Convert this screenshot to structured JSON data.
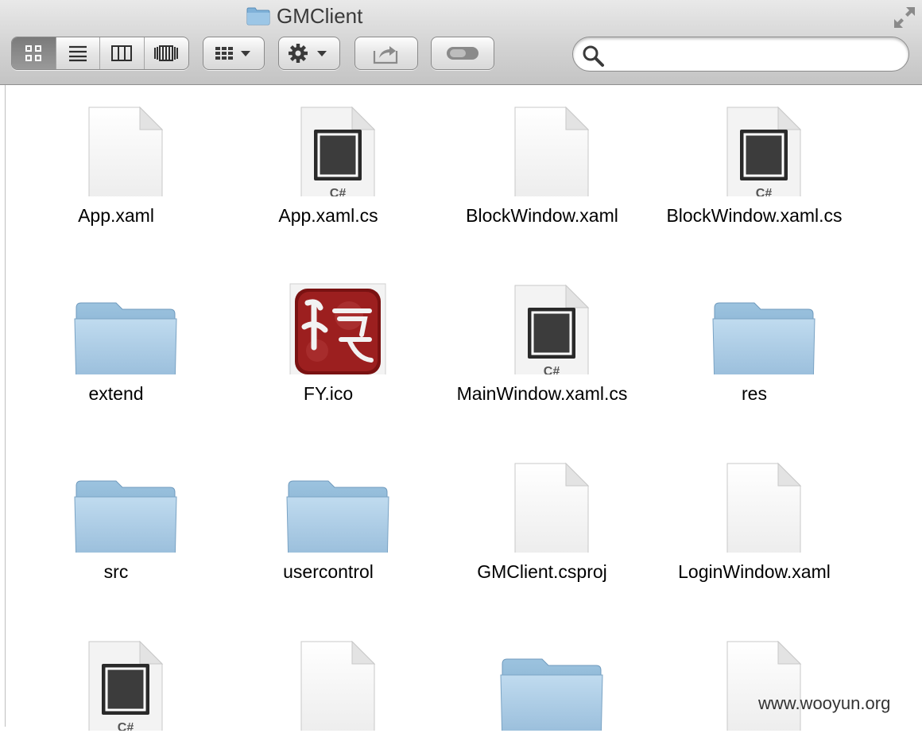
{
  "window": {
    "title": "GMClient"
  },
  "toolbar": {
    "view_buttons": [
      "icon-view",
      "list-view",
      "column-view",
      "cover-flow-view"
    ],
    "arrange_icon": "arrange-grid-icon",
    "action_icon": "gear-icon",
    "share_icon": "share-icon",
    "tag_icon": "toggle-pill-icon"
  },
  "search": {
    "value": "",
    "placeholder": ""
  },
  "files": [
    {
      "name": "App.xaml",
      "kind": "document"
    },
    {
      "name": "App.xaml.cs",
      "kind": "csharp"
    },
    {
      "name": "BlockWindow.xaml",
      "kind": "document"
    },
    {
      "name": "BlockWindow.xaml.cs",
      "kind": "csharp"
    },
    {
      "name": "extend",
      "kind": "folder"
    },
    {
      "name": "FY.ico",
      "kind": "image"
    },
    {
      "name": "MainWindow.xaml.cs",
      "kind": "csharp"
    },
    {
      "name": "res",
      "kind": "folder"
    },
    {
      "name": "src",
      "kind": "folder"
    },
    {
      "name": "usercontrol",
      "kind": "folder"
    },
    {
      "name": "GMClient.csproj",
      "kind": "document"
    },
    {
      "name": "LoginWindow.xaml",
      "kind": "document"
    },
    {
      "name": "",
      "kind": "csharp"
    },
    {
      "name": "",
      "kind": "document"
    },
    {
      "name": "",
      "kind": "folder"
    },
    {
      "name": "",
      "kind": "document"
    }
  ],
  "csharp_badge": "C#",
  "watermark": "www.wooyun.org"
}
